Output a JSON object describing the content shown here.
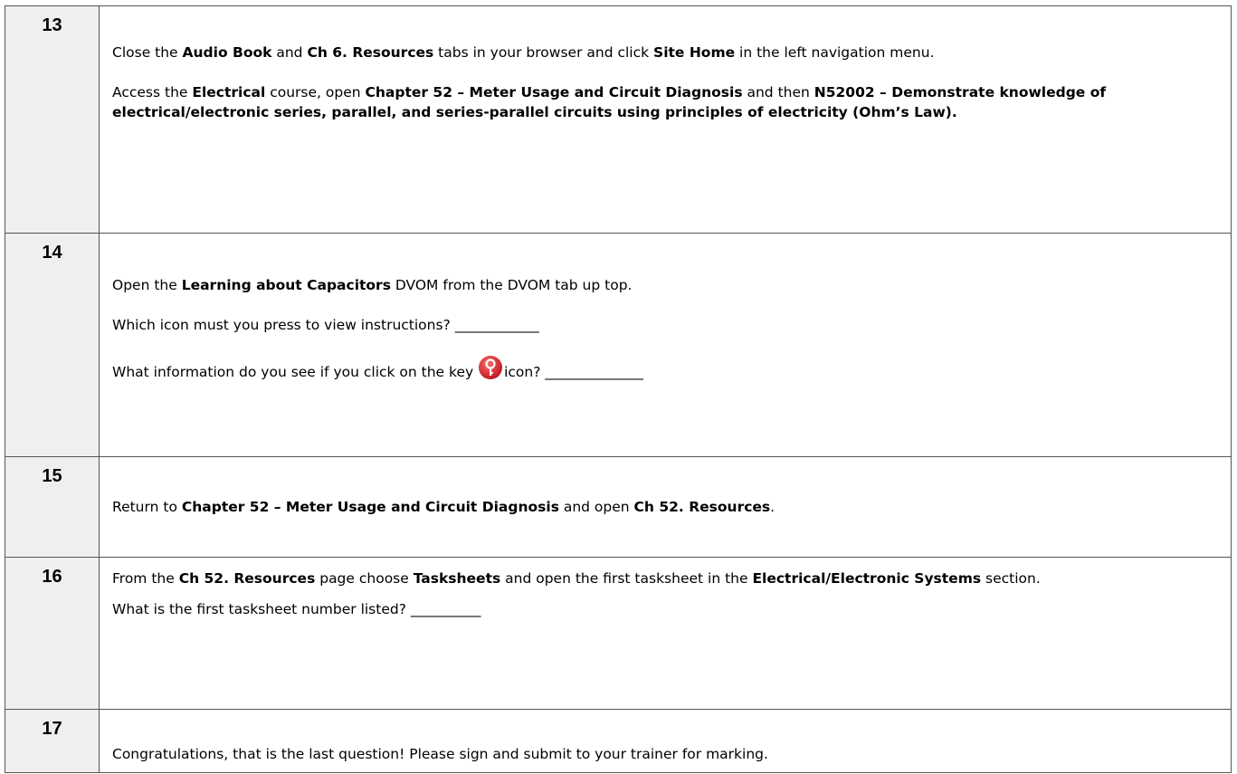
{
  "steps": [
    {
      "number": "13",
      "p1": {
        "t1": "Close the ",
        "b1": "Audio Book",
        "t2": " and ",
        "b2": "Ch 6. Resources",
        "t3": " tabs in your browser and click ",
        "b3": "Site Home",
        "t4": " in the left navigation menu."
      },
      "p2": {
        "t1": "Access the ",
        "b1": "Electrical",
        "t2": " course, open ",
        "b2": "Chapter 52 – Meter Usage and Circuit Diagnosis",
        "t3": " and then ",
        "b3": "N52002 – Demonstrate knowledge of electrical/electronic series, parallel, and series-parallel circuits using principles of electricity (Ohm’s Law)."
      }
    },
    {
      "number": "14",
      "p1": {
        "t1": "Open the ",
        "b1": "Learning about Capacitors",
        "t2": " DVOM from the DVOM tab up top."
      },
      "p2": {
        "t1": "Which icon must you press to view instructions? ",
        "blank": "____________"
      },
      "p3": {
        "t1": "What information do you see if you click on the key ",
        "t2": "icon? ",
        "blank": "______________"
      },
      "key_icon": "key-icon"
    },
    {
      "number": "15",
      "p1": {
        "t1": "Return to ",
        "b1": "Chapter 52 – Meter Usage and Circuit Diagnosis",
        "t2": " and open ",
        "b2": "Ch 52. Resources",
        "t3": "."
      }
    },
    {
      "number": "16",
      "p1": {
        "t1": "From the ",
        "b1": "Ch 52. Resources",
        "t2": " page choose ",
        "b2": "Tasksheets",
        "t3": " and open the first tasksheet in the ",
        "b3": "Electrical/Electronic Systems",
        "t4": " section."
      },
      "p2": {
        "t1": "What is the first tasksheet number listed? ",
        "blank": "__________"
      }
    },
    {
      "number": "17",
      "p1": {
        "t1": "Congratulations, that is the last question! Please sign and submit to your trainer for marking."
      }
    }
  ],
  "colors": {
    "number_cell_bg": "#efefef",
    "border": "#555555",
    "key_icon_red": "#d8262c"
  }
}
